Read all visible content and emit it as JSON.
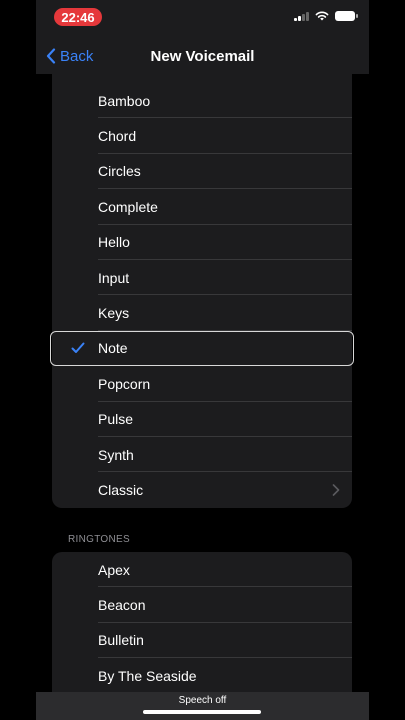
{
  "status": {
    "time": "22:46"
  },
  "nav": {
    "back_label": "Back",
    "title": "New Voicemail"
  },
  "alert_tones": [
    {
      "label": "Bamboo"
    },
    {
      "label": "Chord"
    },
    {
      "label": "Circles"
    },
    {
      "label": "Complete"
    },
    {
      "label": "Hello"
    },
    {
      "label": "Input"
    },
    {
      "label": "Keys"
    },
    {
      "label": "Note",
      "selected": true
    },
    {
      "label": "Popcorn"
    },
    {
      "label": "Pulse"
    },
    {
      "label": "Synth"
    },
    {
      "label": "Classic",
      "chevron": true
    }
  ],
  "ringtones_header": "RINGTONES",
  "ringtones": [
    {
      "label": "Apex"
    },
    {
      "label": "Beacon"
    },
    {
      "label": "Bulletin"
    },
    {
      "label": "By The Seaside"
    }
  ],
  "speech_status": "Speech off",
  "colors": {
    "accent": "#3a82f7",
    "time_pill": "#e5383b",
    "cell_bg": "#1c1c1e"
  }
}
